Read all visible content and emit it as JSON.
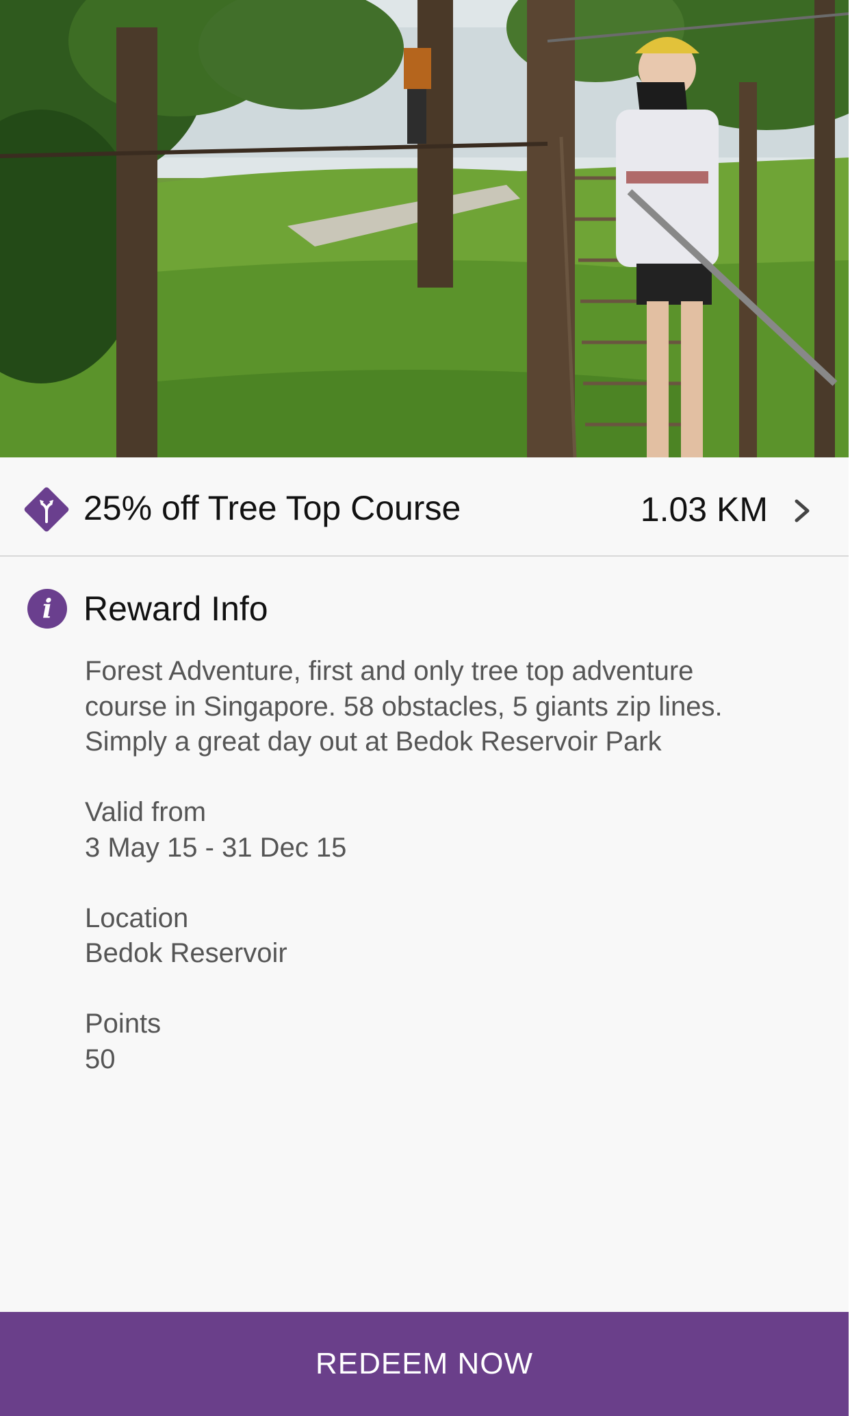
{
  "hero": {
    "image": "forest-adventure-photo"
  },
  "reward": {
    "icon": "diamond-directions-icon",
    "title": "25% off Tree Top Course",
    "distance": "1.03 KM",
    "chevron_icon": "chevron-right-icon"
  },
  "info": {
    "icon": "info-icon",
    "icon_glyph": "i",
    "heading": "Reward Info",
    "description_lines": [
      "Forest Adventure, first and only tree top adventure",
      "course in Singapore. 58 obstacles, 5 giants zip lines.",
      "Simply a great day out at Bedok Reservoir Park"
    ],
    "valid_label": "Valid from",
    "valid_value": "3 May 15 - 31 Dec 15",
    "location_label": "Location",
    "location_value": "Bedok Reservoir",
    "points_label": "Points",
    "points_value": "50"
  },
  "actions": {
    "redeem_label": "REDEEM NOW"
  },
  "colors": {
    "accent": "#6a3f8a",
    "background": "#f8f8f8",
    "text_primary": "#111111",
    "text_secondary": "#555555"
  }
}
